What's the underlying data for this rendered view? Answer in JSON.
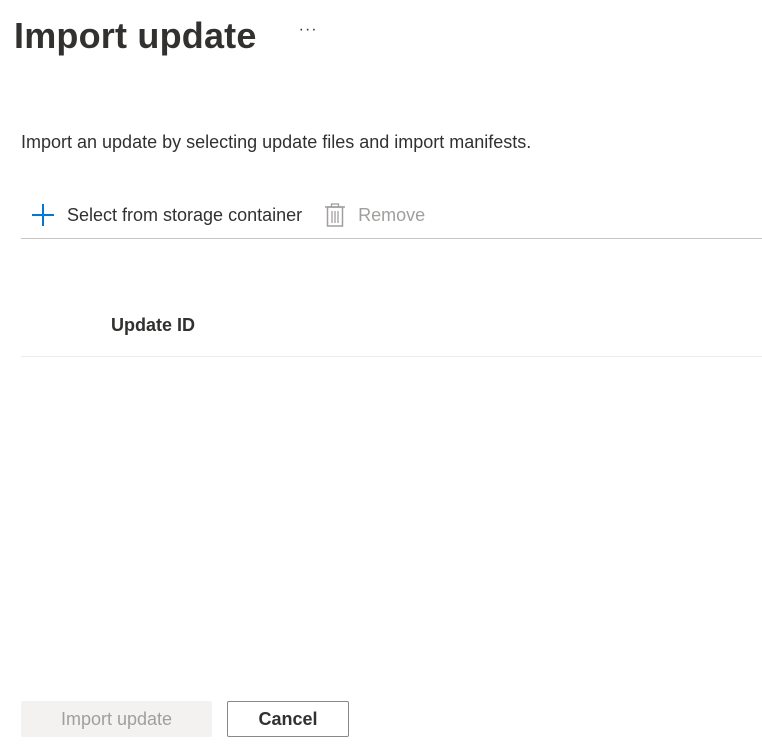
{
  "header": {
    "title": "Import update",
    "more_label": "···"
  },
  "description": "Import an update by selecting update files and import manifests.",
  "toolbar": {
    "add_label": "Select from storage container",
    "remove_label": "Remove"
  },
  "table": {
    "columns": [
      "Update ID"
    ],
    "rows": []
  },
  "footer": {
    "import_label": "Import update",
    "cancel_label": "Cancel"
  },
  "colors": {
    "accent": "#0078d4",
    "text": "#323130",
    "disabled_text": "#a19f9d",
    "disabled_bg": "#f3f2f1"
  },
  "icons": {
    "add": "plus-icon",
    "remove": "trash-icon"
  }
}
